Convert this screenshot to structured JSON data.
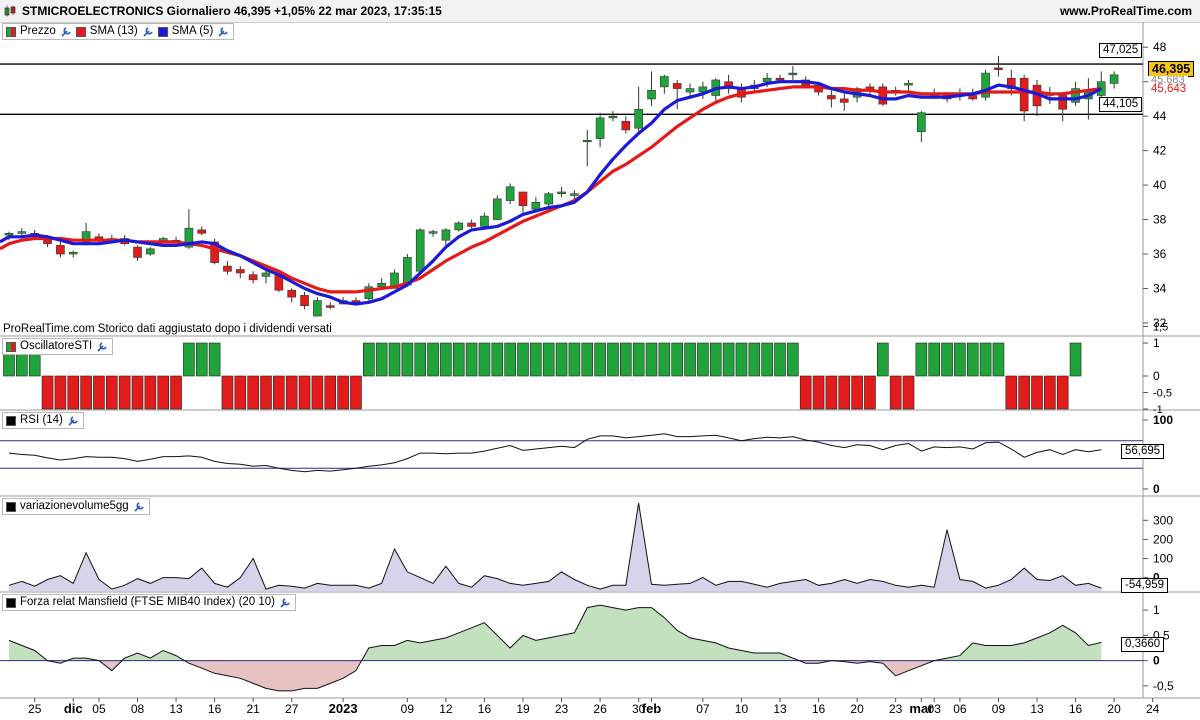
{
  "header": {
    "title": "STMICROELECTRONICS Giornaliero 46,395 +1,05% 22 mar 2023, 17:35:15",
    "site": "www.ProRealTime.com"
  },
  "colors": {
    "up": "#1fa33a",
    "down": "#e21b1b",
    "sma13": "#e61919",
    "sma5": "#1a1ad8",
    "panel_border": "#9a9a9a",
    "grid": "#dddddd",
    "price_tag": "#f5c518"
  },
  "price_panel": {
    "legend": {
      "price": "Prezzo",
      "sma13": "SMA (13)",
      "sma5": "SMA (5)"
    },
    "note": "ProRealTime.com Storico dati aggiustato dopo i dividendi versati",
    "hline_labels": [
      "47,025",
      "44,105"
    ],
    "last_price_label": "46,395",
    "sma13_label": "45,643",
    "sma5_label": "45,683",
    "yticks": [
      "48",
      "46",
      "44",
      "42",
      "40",
      "38",
      "36",
      "34",
      "32"
    ]
  },
  "sti_panel": {
    "legend": "OscillatoreSTI",
    "yticks": [
      "1,5",
      "1",
      "0",
      "-0,5",
      "-1"
    ]
  },
  "rsi_panel": {
    "legend": "RSI (14)",
    "yticks": [
      "100",
      "0"
    ],
    "value_label": "56,695"
  },
  "vol_panel": {
    "legend": "variazionevolume5gg",
    "yticks": [
      "300",
      "200",
      "100",
      "0"
    ],
    "value_label": "-54,959"
  },
  "mans_panel": {
    "legend": "Forza relat Mansfield (FTSE MIB40 Index) (20 10)",
    "yticks": [
      "1",
      "0,5",
      "0",
      "-0,5"
    ],
    "value_label": "0,3660"
  },
  "xaxis": {
    "labels": [
      "25",
      "dic",
      "05",
      "08",
      "13",
      "16",
      "21",
      "27",
      "2023",
      "09",
      "12",
      "16",
      "19",
      "23",
      "26",
      "30",
      "feb",
      "07",
      "10",
      "13",
      "16",
      "20",
      "23",
      "mar",
      "03",
      "06",
      "09",
      "13",
      "16",
      "20",
      "24"
    ],
    "bold": [
      "dic",
      "2023",
      "feb",
      "mar"
    ]
  },
  "chart_data": [
    {
      "type": "candlestick",
      "title": "STMICROELECTRONICS Giornaliero",
      "ylim": [
        31.3,
        49
      ],
      "horizontal_lines": [
        47.025,
        44.105
      ],
      "x": [
        "2022-11-22",
        "2022-11-23",
        "2022-11-24",
        "2022-11-25",
        "2022-11-28",
        "2022-11-29",
        "2022-11-30",
        "2022-12-01",
        "2022-12-02",
        "2022-12-05",
        "2022-12-06",
        "2022-12-07",
        "2022-12-08",
        "2022-12-09",
        "2022-12-12",
        "2022-12-13",
        "2022-12-14",
        "2022-12-15",
        "2022-12-16",
        "2022-12-19",
        "2022-12-20",
        "2022-12-21",
        "2022-12-22",
        "2022-12-23",
        "2022-12-27",
        "2022-12-28",
        "2022-12-29",
        "2022-12-30",
        "2023-01-02",
        "2023-01-03",
        "2023-01-04",
        "2023-01-05",
        "2023-01-06",
        "2023-01-09",
        "2023-01-10",
        "2023-01-11",
        "2023-01-12",
        "2023-01-13",
        "2023-01-16",
        "2023-01-17",
        "2023-01-18",
        "2023-01-19",
        "2023-01-20",
        "2023-01-23",
        "2023-01-24",
        "2023-01-25",
        "2023-01-26",
        "2023-01-27",
        "2023-01-30",
        "2023-01-31",
        "2023-02-01",
        "2023-02-02",
        "2023-02-03",
        "2023-02-06",
        "2023-02-07",
        "2023-02-08",
        "2023-02-09",
        "2023-02-10",
        "2023-02-13",
        "2023-02-14",
        "2023-02-15",
        "2023-02-16",
        "2023-02-17",
        "2023-02-20",
        "2023-02-21",
        "2023-02-22",
        "2023-02-23",
        "2023-02-24",
        "2023-02-27",
        "2023-02-28",
        "2023-03-01",
        "2023-03-02",
        "2023-03-03",
        "2023-03-06",
        "2023-03-07",
        "2023-03-08",
        "2023-03-09",
        "2023-03-10",
        "2023-03-13",
        "2023-03-14",
        "2023-03-15",
        "2023-03-16",
        "2023-03-17",
        "2023-03-20",
        "2023-03-21",
        "2023-03-22"
      ],
      "ohlc": [
        [
          37.1,
          37.3,
          36.8,
          37.2
        ],
        [
          37.2,
          37.5,
          37.0,
          37.3
        ],
        [
          37.2,
          37.4,
          36.9,
          37.0
        ],
        [
          36.9,
          37.1,
          36.4,
          36.6
        ],
        [
          36.5,
          36.7,
          35.8,
          36.0
        ],
        [
          36.0,
          36.2,
          35.8,
          36.1
        ],
        [
          36.7,
          37.8,
          36.5,
          37.3
        ],
        [
          37.0,
          37.2,
          36.6,
          36.8
        ],
        [
          36.8,
          37.1,
          36.6,
          36.9
        ],
        [
          36.9,
          37.1,
          36.5,
          36.6
        ],
        [
          36.4,
          36.5,
          35.6,
          35.8
        ],
        [
          36.0,
          36.4,
          35.9,
          36.3
        ],
        [
          36.7,
          37.0,
          36.6,
          36.9
        ],
        [
          36.8,
          37.0,
          36.7,
          36.8
        ],
        [
          36.4,
          38.6,
          36.3,
          37.5
        ],
        [
          37.4,
          37.6,
          37.1,
          37.2
        ],
        [
          36.7,
          36.9,
          35.4,
          35.5
        ],
        [
          35.3,
          35.6,
          34.8,
          35.0
        ],
        [
          35.1,
          35.3,
          34.6,
          34.9
        ],
        [
          34.8,
          35.0,
          34.3,
          34.5
        ],
        [
          34.7,
          35.2,
          34.3,
          34.9
        ],
        [
          34.8,
          35.0,
          33.8,
          33.9
        ],
        [
          33.9,
          34.0,
          33.2,
          33.5
        ],
        [
          33.6,
          33.8,
          32.8,
          33.0
        ],
        [
          32.4,
          33.5,
          32.4,
          33.3
        ],
        [
          33.0,
          33.2,
          32.8,
          32.9
        ],
        [
          33.1,
          33.5,
          33.1,
          33.3
        ],
        [
          33.3,
          33.5,
          33.0,
          33.2
        ],
        [
          33.4,
          34.3,
          33.3,
          34.1
        ],
        [
          34.1,
          34.6,
          33.9,
          34.3
        ],
        [
          34.0,
          35.1,
          34.0,
          34.9
        ],
        [
          34.2,
          36.0,
          34.1,
          35.8
        ],
        [
          35.0,
          37.5,
          34.9,
          37.4
        ],
        [
          37.2,
          37.4,
          37.0,
          37.3
        ],
        [
          36.8,
          37.5,
          36.5,
          37.4
        ],
        [
          37.4,
          37.9,
          37.3,
          37.8
        ],
        [
          37.8,
          38.0,
          37.5,
          37.6
        ],
        [
          37.6,
          38.4,
          37.5,
          38.2
        ],
        [
          38.0,
          39.4,
          38.0,
          39.2
        ],
        [
          39.1,
          40.1,
          38.9,
          39.9
        ],
        [
          39.6,
          39.6,
          38.4,
          38.8
        ],
        [
          38.6,
          39.3,
          38.4,
          39.0
        ],
        [
          38.9,
          39.6,
          38.8,
          39.5
        ],
        [
          39.5,
          39.9,
          39.3,
          39.6
        ],
        [
          39.4,
          39.7,
          39.1,
          39.5
        ],
        [
          42.6,
          43.2,
          41.1,
          42.6
        ],
        [
          42.7,
          44.2,
          42.2,
          43.9
        ],
        [
          43.9,
          44.3,
          43.7,
          44.0
        ],
        [
          43.7,
          44.0,
          43.0,
          43.2
        ],
        [
          43.3,
          45.7,
          43.1,
          44.4
        ],
        [
          45.0,
          46.6,
          44.6,
          45.5
        ],
        [
          45.7,
          46.4,
          45.3,
          46.3
        ],
        [
          45.9,
          46.1,
          44.4,
          45.6
        ],
        [
          45.4,
          45.9,
          45.1,
          45.6
        ],
        [
          45.4,
          46.0,
          45.0,
          45.7
        ],
        [
          45.2,
          46.2,
          44.9,
          46.1
        ],
        [
          46.0,
          46.4,
          45.3,
          45.6
        ],
        [
          45.6,
          45.9,
          44.8,
          45.1
        ],
        [
          45.6,
          46.1,
          45.4,
          45.8
        ],
        [
          46.0,
          46.5,
          45.7,
          46.2
        ],
        [
          46.2,
          46.4,
          45.9,
          46.1
        ],
        [
          46.4,
          46.9,
          46.1,
          46.5
        ],
        [
          46.1,
          46.3,
          45.6,
          45.8
        ],
        [
          45.8,
          46.0,
          45.2,
          45.4
        ],
        [
          45.2,
          45.5,
          44.5,
          45.0
        ],
        [
          45.0,
          45.3,
          44.3,
          44.8
        ],
        [
          45.1,
          45.7,
          44.8,
          45.6
        ],
        [
          45.7,
          45.9,
          45.3,
          45.5
        ],
        [
          45.7,
          45.9,
          44.6,
          44.7
        ],
        [
          45.4,
          45.7,
          45.2,
          45.5
        ],
        [
          45.8,
          46.1,
          45.5,
          45.9
        ],
        [
          43.1,
          44.3,
          42.5,
          44.2
        ],
        [
          45.3,
          45.6,
          45.0,
          45.2
        ],
        [
          45.3,
          45.4,
          44.8,
          45.0
        ],
        [
          45.3,
          45.6,
          44.9,
          45.2
        ],
        [
          45.2,
          45.6,
          44.9,
          45.0
        ],
        [
          45.1,
          46.7,
          44.9,
          46.5
        ],
        [
          46.8,
          47.5,
          46.3,
          46.7
        ],
        [
          46.2,
          46.7,
          45.2,
          45.6
        ],
        [
          46.2,
          46.4,
          43.7,
          44.3
        ],
        [
          45.8,
          46.1,
          44.0,
          44.6
        ],
        [
          45.2,
          45.7,
          44.7,
          45.3
        ],
        [
          45.2,
          45.4,
          43.7,
          44.4
        ],
        [
          44.8,
          46.0,
          44.6,
          45.6
        ],
        [
          45.0,
          46.2,
          43.8,
          45.4
        ],
        [
          45.2,
          46.6,
          45.0,
          46.0
        ],
        [
          45.9,
          46.6,
          45.6,
          46.4
        ]
      ],
      "series": [
        {
          "name": "SMA (13)",
          "values": [
            36.6,
            36.8,
            36.9,
            36.9,
            36.9,
            36.8,
            36.8,
            36.8,
            36.8,
            36.8,
            36.7,
            36.7,
            36.7,
            36.7,
            36.6,
            36.5,
            36.3,
            36.1,
            35.9,
            35.6,
            35.3,
            35.0,
            34.6,
            34.3,
            34.0,
            33.8,
            33.8,
            33.8,
            33.9,
            34.0,
            34.1,
            34.3,
            34.6,
            35.1,
            35.6,
            36.0,
            36.4,
            36.7,
            37.1,
            37.5,
            37.9,
            38.2,
            38.5,
            38.8,
            39.1,
            39.6,
            40.2,
            40.8,
            41.2,
            41.7,
            42.2,
            42.8,
            43.4,
            43.9,
            44.4,
            44.8,
            45.1,
            45.3,
            45.4,
            45.5,
            45.6,
            45.7,
            45.7,
            45.7,
            45.6,
            45.6,
            45.5,
            45.5,
            45.4,
            45.4,
            45.4,
            45.3,
            45.3,
            45.3,
            45.3,
            45.3,
            45.4,
            45.4,
            45.4,
            45.4,
            45.4,
            45.3,
            45.3,
            45.4,
            45.5,
            45.6
          ]
        },
        {
          "name": "SMA (5)",
          "values": [
            37.0,
            37.0,
            37.1,
            37.0,
            36.8,
            36.6,
            36.6,
            36.6,
            36.7,
            36.8,
            36.7,
            36.6,
            36.5,
            36.5,
            36.6,
            36.7,
            36.6,
            36.2,
            35.9,
            35.5,
            35.1,
            34.8,
            34.4,
            34.0,
            33.7,
            33.5,
            33.2,
            33.1,
            33.2,
            33.4,
            33.8,
            34.2,
            34.9,
            35.6,
            36.4,
            37.0,
            37.4,
            37.5,
            37.6,
            37.9,
            38.3,
            38.5,
            38.7,
            38.8,
            39.0,
            39.6,
            40.6,
            41.5,
            42.3,
            43.0,
            43.6,
            44.4,
            44.9,
            45.1,
            45.3,
            45.6,
            45.7,
            45.6,
            45.7,
            45.9,
            46.0,
            46.0,
            46.0,
            45.9,
            45.6,
            45.4,
            45.3,
            45.2,
            45.0,
            45.0,
            45.2,
            45.1,
            45.1,
            45.1,
            45.2,
            45.3,
            45.5,
            45.8,
            45.7,
            45.5,
            45.3,
            45.0,
            45.0,
            45.0,
            45.2,
            45.6
          ]
        }
      ]
    },
    {
      "type": "bar",
      "name": "OscillatoreSTI",
      "values": [
        1,
        1,
        1,
        -1,
        -1,
        -1,
        -1,
        -1,
        -1,
        -1,
        -1,
        -1,
        -1,
        -1,
        1,
        1,
        1,
        -1,
        -1,
        -1,
        -1,
        -1,
        -1,
        -1,
        -1,
        -1,
        -1,
        -1,
        1,
        1,
        1,
        1,
        1,
        1,
        1,
        1,
        1,
        1,
        1,
        1,
        1,
        1,
        1,
        1,
        1,
        1,
        1,
        1,
        1,
        1,
        1,
        1,
        1,
        1,
        1,
        1,
        1,
        1,
        1,
        1,
        1,
        1,
        -1,
        -1,
        -1,
        -1,
        -1,
        -1,
        1,
        -1,
        -1,
        1,
        1,
        1,
        1,
        1,
        1,
        1,
        -1,
        -1,
        -1,
        -1,
        -1,
        1
      ]
    },
    {
      "type": "line",
      "name": "RSI (14)",
      "ylim": [
        0,
        100
      ],
      "horizontal_lines": [
        70,
        30
      ],
      "values": [
        52,
        50,
        49,
        45,
        42,
        44,
        47,
        46,
        46,
        44,
        40,
        43,
        47,
        47,
        48,
        46,
        40,
        37,
        36,
        33,
        34,
        30,
        27,
        25,
        27,
        26,
        28,
        30,
        33,
        35,
        38,
        44,
        52,
        52,
        51,
        52,
        52,
        55,
        59,
        63,
        56,
        58,
        60,
        62,
        60,
        72,
        77,
        77,
        74,
        76,
        78,
        80,
        76,
        76,
        77,
        78,
        74,
        70,
        73,
        75,
        74,
        76,
        71,
        68,
        63,
        60,
        64,
        63,
        57,
        63,
        66,
        55,
        61,
        60,
        61,
        58,
        67,
        68,
        58,
        46,
        53,
        57,
        50,
        57,
        54,
        57
      ]
    },
    {
      "type": "area",
      "name": "variazionevolume5gg",
      "ylim": [
        -70,
        380
      ],
      "values": [
        -40,
        -20,
        -45,
        -10,
        10,
        -30,
        130,
        -10,
        -60,
        -40,
        -5,
        -30,
        0,
        0,
        -5,
        50,
        -30,
        -50,
        0,
        100,
        -60,
        -40,
        -45,
        -55,
        -30,
        -40,
        -40,
        -40,
        -55,
        -30,
        150,
        30,
        0,
        -30,
        60,
        -30,
        -50,
        10,
        -5,
        -30,
        -40,
        -30,
        -20,
        30,
        -10,
        -40,
        -60,
        -40,
        -40,
        390,
        -35,
        -40,
        -35,
        -30,
        0,
        -40,
        -20,
        -20,
        -35,
        -50,
        -30,
        -20,
        -10,
        -40,
        -30,
        -10,
        -30,
        -10,
        -20,
        -40,
        -50,
        -40,
        -50,
        250,
        -10,
        -20,
        -55,
        -40,
        -10,
        50,
        -10,
        -15,
        10,
        -40,
        -30,
        -55
      ]
    },
    {
      "type": "area",
      "name": "Forza relat Mansfield (FTSE MIB40 Index) (20 10)",
      "ylim": [
        -0.72,
        1.2
      ],
      "values": [
        0.4,
        0.3,
        0.2,
        0.0,
        -0.05,
        0.05,
        0.05,
        0.0,
        -0.2,
        0.05,
        0.15,
        0.05,
        0.2,
        0.1,
        -0.05,
        -0.15,
        -0.25,
        -0.3,
        -0.35,
        -0.45,
        -0.55,
        -0.6,
        -0.6,
        -0.55,
        -0.55,
        -0.45,
        -0.35,
        -0.2,
        0.25,
        0.3,
        0.3,
        0.4,
        0.35,
        0.4,
        0.45,
        0.55,
        0.65,
        0.75,
        0.5,
        0.25,
        0.5,
        0.4,
        0.45,
        0.5,
        0.55,
        1.05,
        1.1,
        1.05,
        1.0,
        1.05,
        1.05,
        0.85,
        0.6,
        0.45,
        0.4,
        0.35,
        0.25,
        0.2,
        0.15,
        0.15,
        0.15,
        0.05,
        -0.05,
        -0.05,
        0.0,
        -0.02,
        -0.05,
        -0.02,
        -0.05,
        -0.3,
        -0.2,
        -0.1,
        0.0,
        0.05,
        0.1,
        0.35,
        0.3,
        0.3,
        0.3,
        0.35,
        0.45,
        0.55,
        0.7,
        0.55,
        0.3,
        0.36
      ]
    }
  ]
}
